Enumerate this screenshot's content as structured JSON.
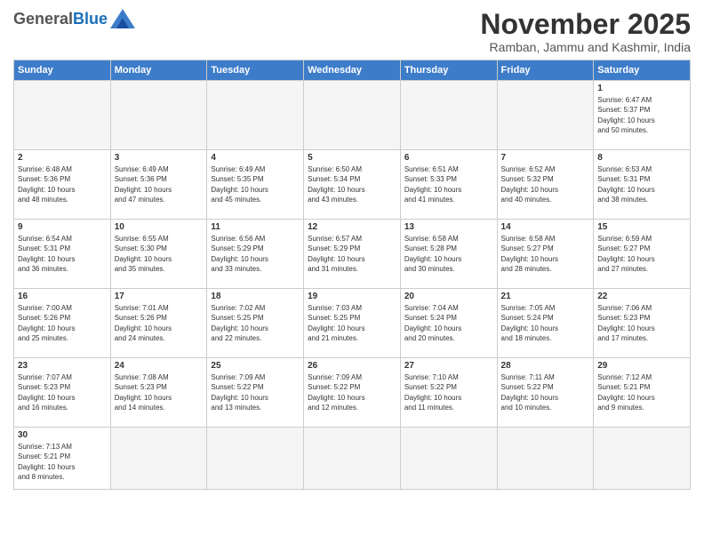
{
  "logo": {
    "general": "General",
    "blue": "Blue"
  },
  "header": {
    "title": "November 2025",
    "subtitle": "Ramban, Jammu and Kashmir, India"
  },
  "weekdays": [
    "Sunday",
    "Monday",
    "Tuesday",
    "Wednesday",
    "Thursday",
    "Friday",
    "Saturday"
  ],
  "weeks": [
    [
      {
        "day": "",
        "info": ""
      },
      {
        "day": "",
        "info": ""
      },
      {
        "day": "",
        "info": ""
      },
      {
        "day": "",
        "info": ""
      },
      {
        "day": "",
        "info": ""
      },
      {
        "day": "",
        "info": ""
      },
      {
        "day": "1",
        "info": "Sunrise: 6:47 AM\nSunset: 5:37 PM\nDaylight: 10 hours\nand 50 minutes."
      }
    ],
    [
      {
        "day": "2",
        "info": "Sunrise: 6:48 AM\nSunset: 5:36 PM\nDaylight: 10 hours\nand 48 minutes."
      },
      {
        "day": "3",
        "info": "Sunrise: 6:49 AM\nSunset: 5:36 PM\nDaylight: 10 hours\nand 47 minutes."
      },
      {
        "day": "4",
        "info": "Sunrise: 6:49 AM\nSunset: 5:35 PM\nDaylight: 10 hours\nand 45 minutes."
      },
      {
        "day": "5",
        "info": "Sunrise: 6:50 AM\nSunset: 5:34 PM\nDaylight: 10 hours\nand 43 minutes."
      },
      {
        "day": "6",
        "info": "Sunrise: 6:51 AM\nSunset: 5:33 PM\nDaylight: 10 hours\nand 41 minutes."
      },
      {
        "day": "7",
        "info": "Sunrise: 6:52 AM\nSunset: 5:32 PM\nDaylight: 10 hours\nand 40 minutes."
      },
      {
        "day": "8",
        "info": "Sunrise: 6:53 AM\nSunset: 5:31 PM\nDaylight: 10 hours\nand 38 minutes."
      }
    ],
    [
      {
        "day": "9",
        "info": "Sunrise: 6:54 AM\nSunset: 5:31 PM\nDaylight: 10 hours\nand 36 minutes."
      },
      {
        "day": "10",
        "info": "Sunrise: 6:55 AM\nSunset: 5:30 PM\nDaylight: 10 hours\nand 35 minutes."
      },
      {
        "day": "11",
        "info": "Sunrise: 6:56 AM\nSunset: 5:29 PM\nDaylight: 10 hours\nand 33 minutes."
      },
      {
        "day": "12",
        "info": "Sunrise: 6:57 AM\nSunset: 5:29 PM\nDaylight: 10 hours\nand 31 minutes."
      },
      {
        "day": "13",
        "info": "Sunrise: 6:58 AM\nSunset: 5:28 PM\nDaylight: 10 hours\nand 30 minutes."
      },
      {
        "day": "14",
        "info": "Sunrise: 6:58 AM\nSunset: 5:27 PM\nDaylight: 10 hours\nand 28 minutes."
      },
      {
        "day": "15",
        "info": "Sunrise: 6:59 AM\nSunset: 5:27 PM\nDaylight: 10 hours\nand 27 minutes."
      }
    ],
    [
      {
        "day": "16",
        "info": "Sunrise: 7:00 AM\nSunset: 5:26 PM\nDaylight: 10 hours\nand 25 minutes."
      },
      {
        "day": "17",
        "info": "Sunrise: 7:01 AM\nSunset: 5:26 PM\nDaylight: 10 hours\nand 24 minutes."
      },
      {
        "day": "18",
        "info": "Sunrise: 7:02 AM\nSunset: 5:25 PM\nDaylight: 10 hours\nand 22 minutes."
      },
      {
        "day": "19",
        "info": "Sunrise: 7:03 AM\nSunset: 5:25 PM\nDaylight: 10 hours\nand 21 minutes."
      },
      {
        "day": "20",
        "info": "Sunrise: 7:04 AM\nSunset: 5:24 PM\nDaylight: 10 hours\nand 20 minutes."
      },
      {
        "day": "21",
        "info": "Sunrise: 7:05 AM\nSunset: 5:24 PM\nDaylight: 10 hours\nand 18 minutes."
      },
      {
        "day": "22",
        "info": "Sunrise: 7:06 AM\nSunset: 5:23 PM\nDaylight: 10 hours\nand 17 minutes."
      }
    ],
    [
      {
        "day": "23",
        "info": "Sunrise: 7:07 AM\nSunset: 5:23 PM\nDaylight: 10 hours\nand 16 minutes."
      },
      {
        "day": "24",
        "info": "Sunrise: 7:08 AM\nSunset: 5:23 PM\nDaylight: 10 hours\nand 14 minutes."
      },
      {
        "day": "25",
        "info": "Sunrise: 7:09 AM\nSunset: 5:22 PM\nDaylight: 10 hours\nand 13 minutes."
      },
      {
        "day": "26",
        "info": "Sunrise: 7:09 AM\nSunset: 5:22 PM\nDaylight: 10 hours\nand 12 minutes."
      },
      {
        "day": "27",
        "info": "Sunrise: 7:10 AM\nSunset: 5:22 PM\nDaylight: 10 hours\nand 11 minutes."
      },
      {
        "day": "28",
        "info": "Sunrise: 7:11 AM\nSunset: 5:22 PM\nDaylight: 10 hours\nand 10 minutes."
      },
      {
        "day": "29",
        "info": "Sunrise: 7:12 AM\nSunset: 5:21 PM\nDaylight: 10 hours\nand 9 minutes."
      }
    ],
    [
      {
        "day": "30",
        "info": "Sunrise: 7:13 AM\nSunset: 5:21 PM\nDaylight: 10 hours\nand 8 minutes."
      },
      {
        "day": "",
        "info": ""
      },
      {
        "day": "",
        "info": ""
      },
      {
        "day": "",
        "info": ""
      },
      {
        "day": "",
        "info": ""
      },
      {
        "day": "",
        "info": ""
      },
      {
        "day": "",
        "info": ""
      }
    ]
  ]
}
